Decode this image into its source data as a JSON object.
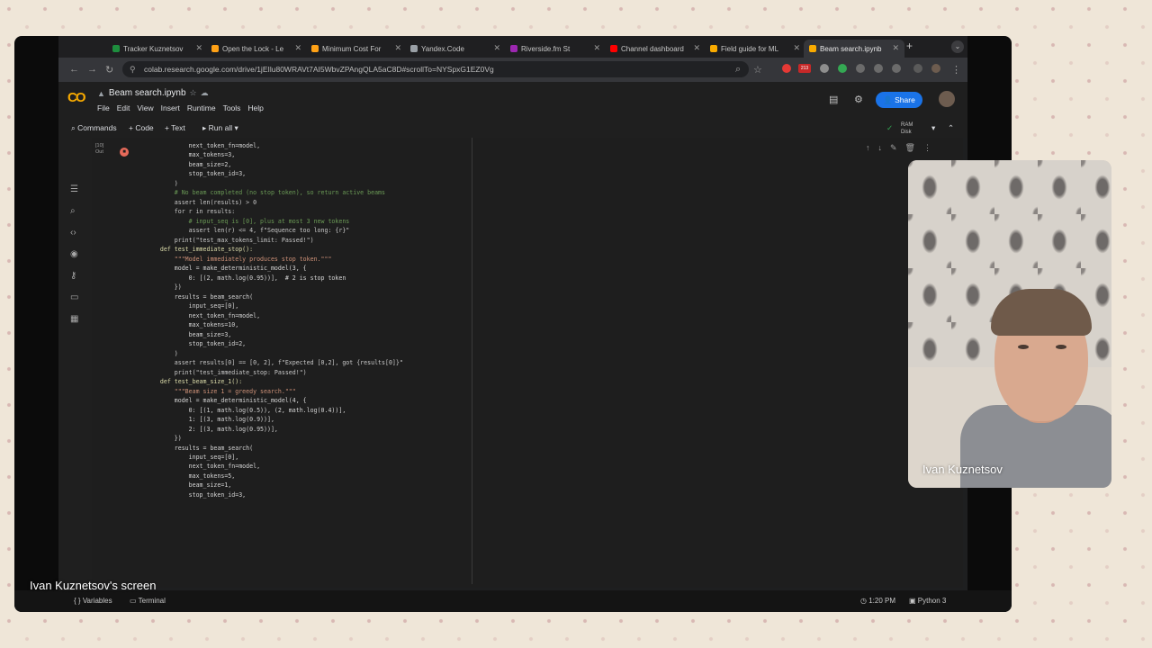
{
  "browser": {
    "tabs": [
      {
        "label": "Tracker Kuznetsov",
        "color": "#1e8e3e"
      },
      {
        "label": "Open the Lock - Le",
        "color": "#ffa116"
      },
      {
        "label": "Minimum Cost For",
        "color": "#ffa116"
      },
      {
        "label": "Yandex.Code",
        "color": "#9aa0a6"
      },
      {
        "label": "Riverside.fm St",
        "color": "#9c27b0"
      },
      {
        "label": "Channel dashboard",
        "color": "#ff0000"
      },
      {
        "label": "Field guide for ML",
        "color": "#f9ab00"
      },
      {
        "label": "Beam search.ipynb",
        "color": "#f9ab00"
      }
    ],
    "url": "colab.research.google.com/drive/1jEIlu80WRAVt7AI5WbvZPAngQLA5aC8D#scrollTo=NYSpxG1EZ0Vg",
    "badge": "213"
  },
  "colab": {
    "logo": "CO",
    "notebook_title": "Beam search.ipynb",
    "menu": [
      "File",
      "Edit",
      "View",
      "Insert",
      "Runtime",
      "Tools",
      "Help"
    ],
    "share_label": "Share",
    "toolbar": {
      "commands": "Commands",
      "code": "+ Code",
      "text": "+ Text",
      "run_all": "Run all",
      "ram": "RAM",
      "disk": "Disk"
    },
    "cell": {
      "exec_count": "[10]",
      "exec_sub": "Out",
      "code_lines": [
        "            next_token_fn=model,",
        "            max_tokens=3,",
        "            beam_size=2,",
        "            stop_token_id=3,",
        "        )",
        "",
        "        # No beam completed (no stop token), so return active beams",
        "        assert len(results) > 0",
        "        for r in results:",
        "            # input_seq is [0], plus at most 3 new tokens",
        "            assert len(r) <= 4, f\"Sequence too long: {r}\"",
        "        print(\"test_max_tokens_limit: Passed!\")",
        "",
        "",
        "    def test_immediate_stop():",
        "        \"\"\"Model immediately produces stop token.\"\"\"",
        "        model = make_deterministic_model(3, {",
        "            0: [(2, math.log(0.95))],  # 2 is stop token",
        "        })",
        "",
        "        results = beam_search(",
        "            input_seq=[0],",
        "            next_token_fn=model,",
        "            max_tokens=10,",
        "            beam_size=3,",
        "            stop_token_id=2,",
        "        )",
        "",
        "        assert results[0] == [0, 2], f\"Expected [0,2], got {results[0]}\"",
        "        print(\"test_immediate_stop: Passed!\")",
        "",
        "",
        "    def test_beam_size_1():",
        "        \"\"\"Beam size 1 = greedy search.\"\"\"",
        "        model = make_deterministic_model(4, {",
        "            0: [(1, math.log(0.5)), (2, math.log(0.4))],",
        "            1: [(3, math.log(0.9))],",
        "            2: [(3, math.log(0.95))],",
        "        })",
        "",
        "        results = beam_search(",
        "            input_seq=[0],",
        "            next_token_fn=model,",
        "            max_tokens=5,",
        "            beam_size=1,",
        "            stop_token_id=3,"
      ]
    },
    "status": {
      "variables": "Variables",
      "terminal": "Terminal",
      "time": "1:20 PM",
      "runtime": "Python 3"
    }
  },
  "overlay": {
    "webcam_name": "Ivan Kuznetsov",
    "screen_label": "Ivan Kuznetsov's screen"
  }
}
